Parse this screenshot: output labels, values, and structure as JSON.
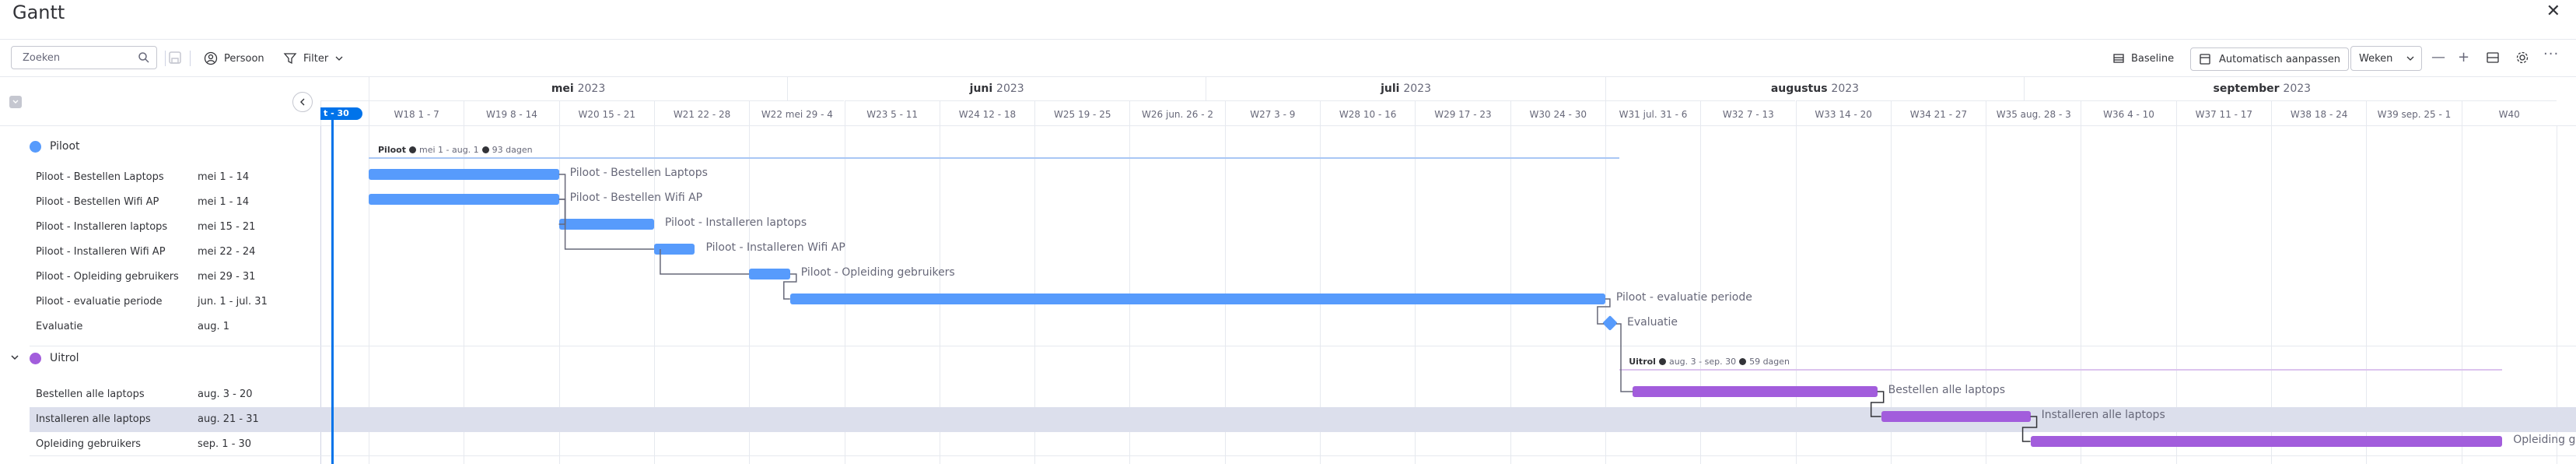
{
  "app": {
    "title": "Gantt"
  },
  "toolbar": {
    "search_placeholder": "Zoeken",
    "person_label": "Persoon",
    "filter_label": "Filter",
    "baseline_label": "Baseline",
    "autofit_label": "Automatisch aanpassen",
    "scale_label": "Weken"
  },
  "timeline": {
    "today_label": "t - 30",
    "months": [
      {
        "name": "mei",
        "year": "2023"
      },
      {
        "name": "juni",
        "year": "2023"
      },
      {
        "name": "juli",
        "year": "2023"
      },
      {
        "name": "augustus",
        "year": "2023"
      },
      {
        "name": "september",
        "year": "2023"
      }
    ],
    "weeks": [
      "W18 1 - 7",
      "W19 8 - 14",
      "W20 15 - 21",
      "W21 22 - 28",
      "W22 mei 29 - 4",
      "W23 5 - 11",
      "W24 12 - 18",
      "W25 19 - 25",
      "W26 jun. 26 - 2",
      "W27 3 - 9",
      "W28 10 - 16",
      "W29 17 - 23",
      "W30 24 - 30",
      "W31 jul. 31 - 6",
      "W32 7 - 13",
      "W33 14 - 20",
      "W34 21 - 27",
      "W35 aug. 28 - 3",
      "W36 4 - 10",
      "W37 11 - 17",
      "W38 18 - 24",
      "W39 sep. 25 - 1",
      "W40"
    ]
  },
  "groups": [
    {
      "name": "Piloot",
      "color": "#579bfc",
      "summary": {
        "name": "Piloot",
        "dates": "mei 1 - aug. 1",
        "duration": "93 dagen"
      },
      "items": [
        {
          "name": "Piloot - Bestellen Laptops",
          "dates": "mei 1 - 14",
          "bar_label": "Piloot - Bestellen Laptops"
        },
        {
          "name": "Piloot - Bestellen Wifi AP",
          "dates": "mei 1 - 14",
          "bar_label": "Piloot - Bestellen Wifi AP"
        },
        {
          "name": "Piloot - Installeren laptops",
          "dates": "mei 15 - 21",
          "bar_label": "Piloot - Installeren laptops"
        },
        {
          "name": "Piloot - Installeren Wifi AP",
          "dates": "mei 22 - 24",
          "bar_label": "Piloot - Installeren Wifi AP"
        },
        {
          "name": "Piloot - Opleiding gebruikers",
          "dates": "mei 29 - 31",
          "bar_label": "Piloot - Opleiding gebruikers"
        },
        {
          "name": "Piloot - evaluatie periode",
          "dates": "jun. 1 - jul. 31",
          "bar_label": "Piloot - evaluatie periode"
        },
        {
          "name": "Evaluatie",
          "dates": "aug. 1",
          "bar_label": "Evaluatie"
        }
      ]
    },
    {
      "name": "Uitrol",
      "color": "#a25ddc",
      "summary": {
        "name": "Uitrol",
        "dates": "aug. 3 - sep. 30",
        "duration": "59 dagen"
      },
      "items": [
        {
          "name": "Bestellen alle laptops",
          "dates": "aug. 3 - 20",
          "bar_label": "Bestellen alle laptops"
        },
        {
          "name": "Installeren alle laptops",
          "dates": "aug. 21 - 31",
          "bar_label": "Installeren alle laptops"
        },
        {
          "name": "Opleiding gebruikers",
          "dates": "sep. 1 - 30",
          "bar_label": "Opleiding gebruikers"
        }
      ]
    }
  ]
}
